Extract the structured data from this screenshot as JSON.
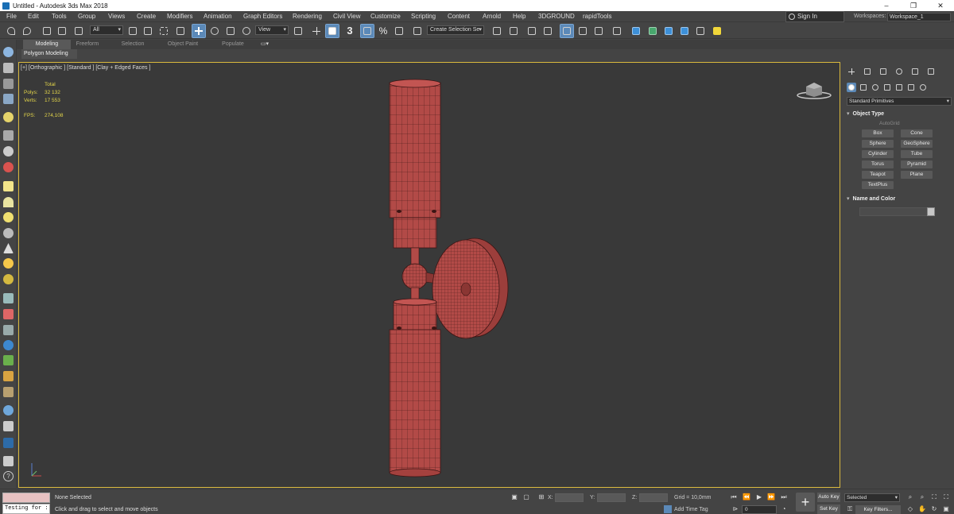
{
  "window": {
    "title": "Untitled - Autodesk 3ds Max 2018",
    "controls": [
      "–",
      "❐",
      "✕"
    ]
  },
  "menu": [
    "File",
    "Edit",
    "Tools",
    "Group",
    "Views",
    "Create",
    "Modifiers",
    "Animation",
    "Graph Editors",
    "Rendering",
    "Civil View",
    "Customize",
    "Scripting",
    "Content",
    "Arnold",
    "Help",
    "3DGROUND",
    "rapidTools"
  ],
  "account": {
    "signin": "Sign In",
    "workspaces_label": "Workspaces:",
    "workspace": "Workspace_1"
  },
  "toolbar": {
    "filter": "All",
    "ref_coord": "View",
    "snap_value": "3",
    "selection_set": "Create Selection Se"
  },
  "ribbon": {
    "tabs": [
      "Modeling",
      "Freeform",
      "Selection",
      "Object Paint",
      "Populate"
    ],
    "active_tab": "Modeling",
    "sub_panel": "Polygon Modeling"
  },
  "viewport": {
    "label": "[+] [Orthographic ] [Standard ] [Clay + Edged Faces ]",
    "stats": {
      "header": "Total",
      "polys_label": "Polys:",
      "polys": "32 132",
      "verts_label": "Verts:",
      "verts": "17 553",
      "fps_label": "FPS:",
      "fps": "274,108"
    },
    "model_color": "#b24a47"
  },
  "command_panel": {
    "dropdown": "Standard Primitives",
    "object_type": {
      "title": "Object Type",
      "autogrid": "AutoGrid",
      "buttons": [
        "Box",
        "Cone",
        "Sphere",
        "GeoSphere",
        "Cylinder",
        "Tube",
        "Torus",
        "Pyramid",
        "Teapot",
        "Plane",
        "TextPlus"
      ]
    },
    "name_color": {
      "title": "Name and Color"
    }
  },
  "statusbar": {
    "script_input": "Testing for :",
    "selection": "None Selected",
    "prompt": "Click and drag to select and move objects",
    "x_label": "X:",
    "y_label": "Y:",
    "z_label": "Z:",
    "grid": "Grid = 10,0mm",
    "add_time_tag": "Add Time Tag",
    "frame": "0",
    "auto_key": "Auto Key",
    "set_key": "Set Key",
    "selected": "Selected",
    "key_filters": "Key Filters..."
  }
}
